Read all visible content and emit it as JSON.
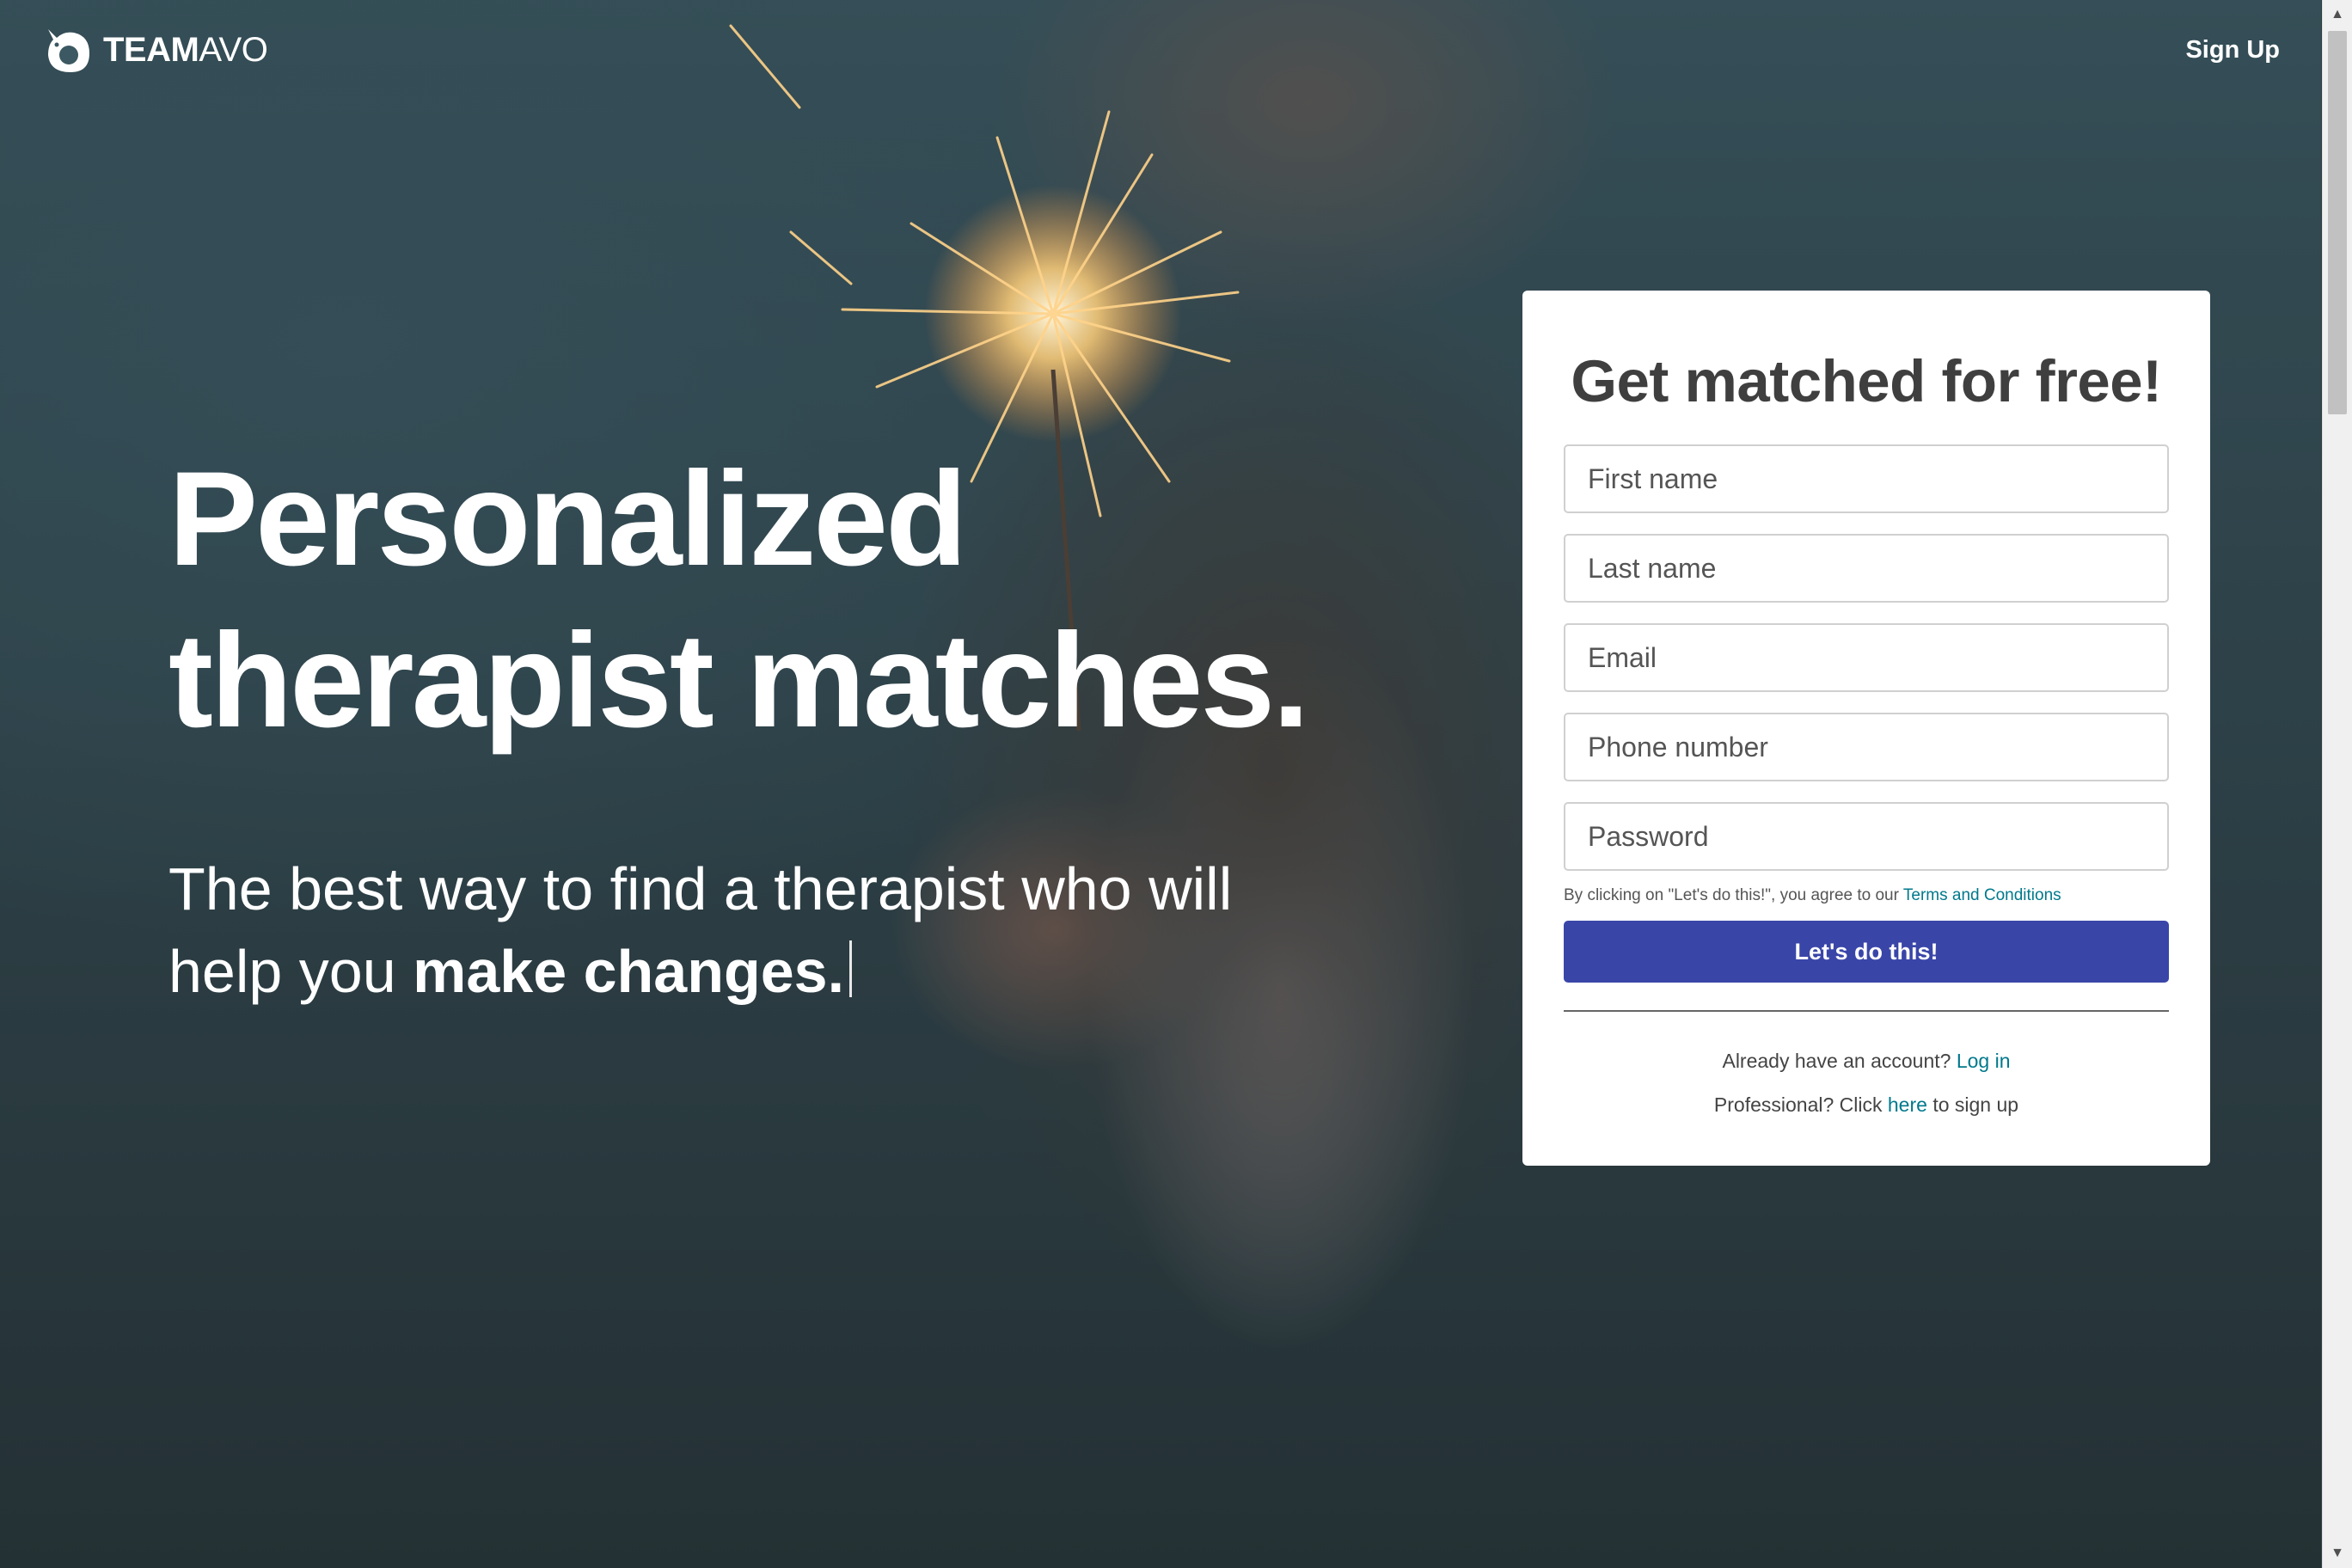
{
  "header": {
    "logo_text_bold": "TEAM",
    "logo_text_light": "AVO",
    "logo_icon": "avocado-bird-icon",
    "signup_label": "Sign Up"
  },
  "hero": {
    "headline_line1": "Personalized",
    "headline_line2": "therapist matches.",
    "subline_part1": "The best way to find a therapist who will help you ",
    "subline_bold": "make changes."
  },
  "form": {
    "title": "Get matched for free!",
    "first_name_placeholder": "First name",
    "last_name_placeholder": "Last name",
    "email_placeholder": "Email",
    "phone_placeholder": "Phone number",
    "password_placeholder": "Password",
    "terms_prefix": "By clicking on \"Let's do this!\", you agree to our ",
    "terms_link": "Terms and Conditions",
    "submit_label": "Let's do this!",
    "login_prefix": "Already have an account? ",
    "login_link": "Log in",
    "pro_prefix": "Professional? Click ",
    "pro_link": "here",
    "pro_suffix": " to sign up"
  },
  "colors": {
    "button": "#3946a8",
    "link": "#00798c",
    "heading": "#3f3f3f"
  }
}
